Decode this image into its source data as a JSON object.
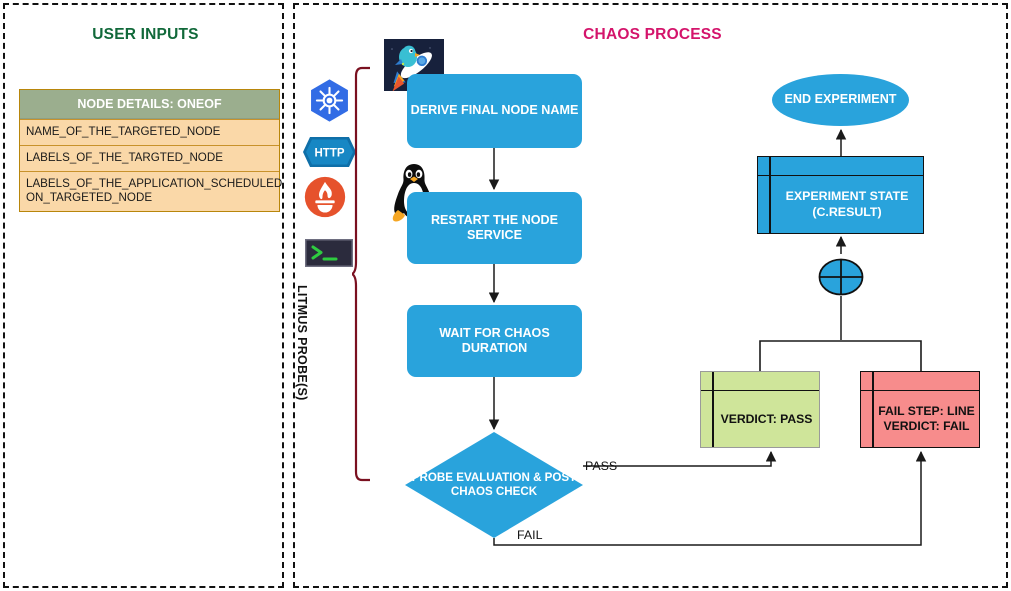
{
  "user_panel": {
    "title": "USER INPUTS",
    "table": {
      "header": "NODE DETAILS: ONEOF",
      "rows": [
        "NAME_OF_THE_TARGETED_NODE",
        "LABELS_OF_THE_TARGTED_NODE",
        "LABELS_OF_THE_APPLICATION_SCHEDULED ON_TARGETED_NODE"
      ],
      "header_color": "#9BAE8E",
      "row_color": "#FAD8A8",
      "border_color": "#B8860B"
    },
    "title_color": "#11693A"
  },
  "chaos_panel": {
    "title": "CHAOS PROCESS",
    "title_color": "#D4146B",
    "probe_rail": {
      "label": "LITMUS PROBE(S)",
      "brace_color": "#7A1020",
      "icons": [
        {
          "name": "kubernetes-probe-icon",
          "label": "Kubernetes"
        },
        {
          "name": "http-probe-icon",
          "label": "HTTP"
        },
        {
          "name": "prometheus-probe-icon",
          "label": "Prometheus"
        },
        {
          "name": "cmd-probe-icon",
          "label": ">_"
        }
      ]
    },
    "nodes": {
      "derive": "DERIVE FINAL NODE NAME",
      "restart": "RESTART THE  NODE SERVICE",
      "wait": "WAIT FOR CHAOS DURATION",
      "decision": "PROBE EVALUATION & POST CHAOS CHECK",
      "end": "END EXPERIMENT",
      "state": "EXPERIMENT STATE (C.RESULT)",
      "verdict_pass": "VERDICT: PASS",
      "verdict_fail": "FAIL STEP: LINE VERDICT: FAIL"
    },
    "edge_labels": {
      "pass": "PASS",
      "fail": "FAIL"
    },
    "colors": {
      "node_blue": "#29A3DC",
      "pass_green": "#CFE59A",
      "fail_red": "#F78C8C",
      "stroke": "#111111"
    }
  }
}
